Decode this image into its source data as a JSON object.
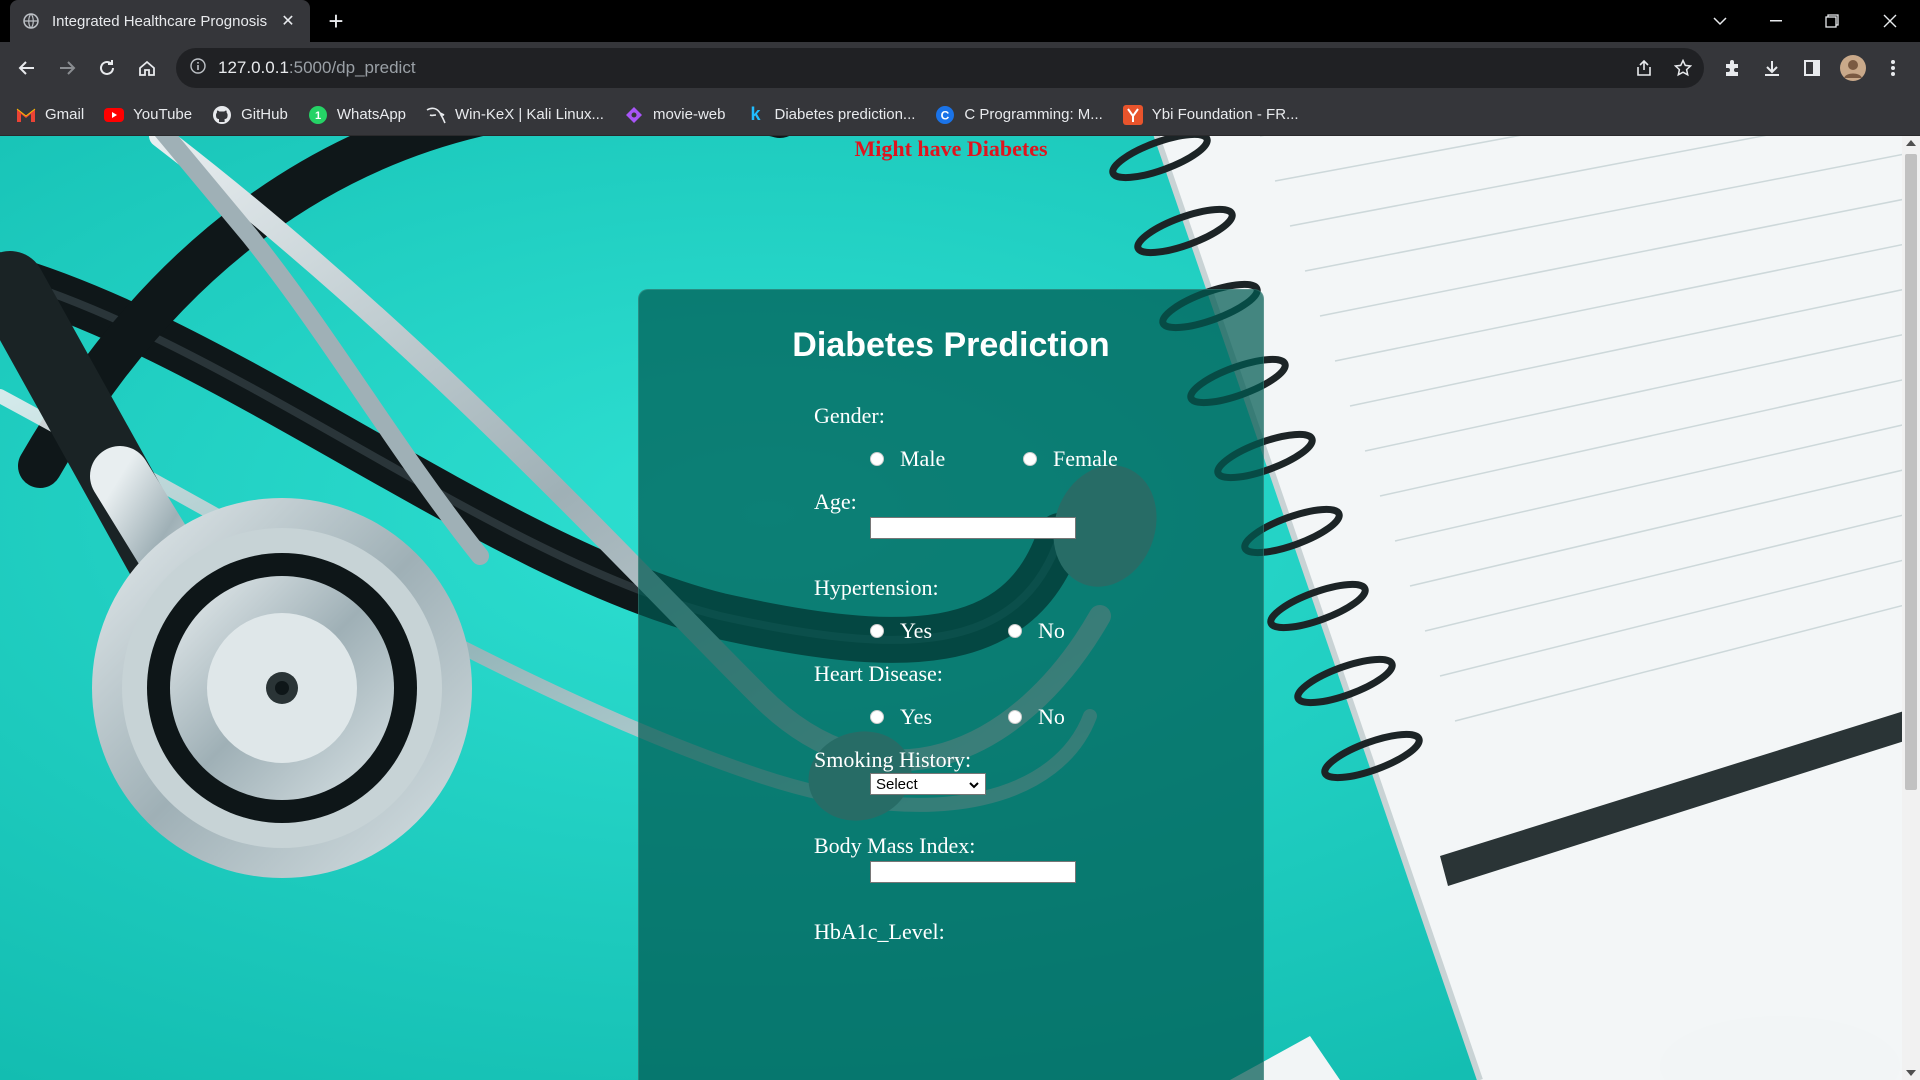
{
  "browser": {
    "tab_title": "Integrated Healthcare Prognosis",
    "url_host": "127.0.0.1",
    "url_path": ":5000/dp_predict",
    "bookmarks": [
      {
        "label": "Gmail",
        "icon": "gmail-icon"
      },
      {
        "label": "YouTube",
        "icon": "youtube-icon"
      },
      {
        "label": "GitHub",
        "icon": "github-icon"
      },
      {
        "label": "WhatsApp",
        "icon": "whatsapp-icon"
      },
      {
        "label": "Win-KeX | Kali Linux...",
        "icon": "kali-icon"
      },
      {
        "label": "movie-web",
        "icon": "movie-web-icon"
      },
      {
        "label": "Diabetes prediction...",
        "icon": "kaggle-icon"
      },
      {
        "label": "C Programming: M...",
        "icon": "c-programming-icon"
      },
      {
        "label": "Ybi Foundation - FR...",
        "icon": "ybi-icon"
      }
    ]
  },
  "page": {
    "result_message": "Might have Diabetes",
    "form": {
      "title": "Diabetes Prediction",
      "gender": {
        "label": "Gender:",
        "options": [
          "Male",
          "Female"
        ]
      },
      "age": {
        "label": "Age:",
        "value": ""
      },
      "hypertension": {
        "label": "Hypertension:",
        "options": [
          "Yes",
          "No"
        ]
      },
      "heart_disease": {
        "label": "Heart Disease:",
        "options": [
          "Yes",
          "No"
        ]
      },
      "smoking_history": {
        "label": "Smoking History:",
        "selected": "Select"
      },
      "bmi": {
        "label": "Body Mass Index:",
        "value": ""
      },
      "hba1c": {
        "label": "HbA1c_Level:"
      }
    }
  },
  "colors": {
    "result_text": "#e0141e",
    "card_bg": "#005a52",
    "page_bg": "#1ed3c6"
  }
}
